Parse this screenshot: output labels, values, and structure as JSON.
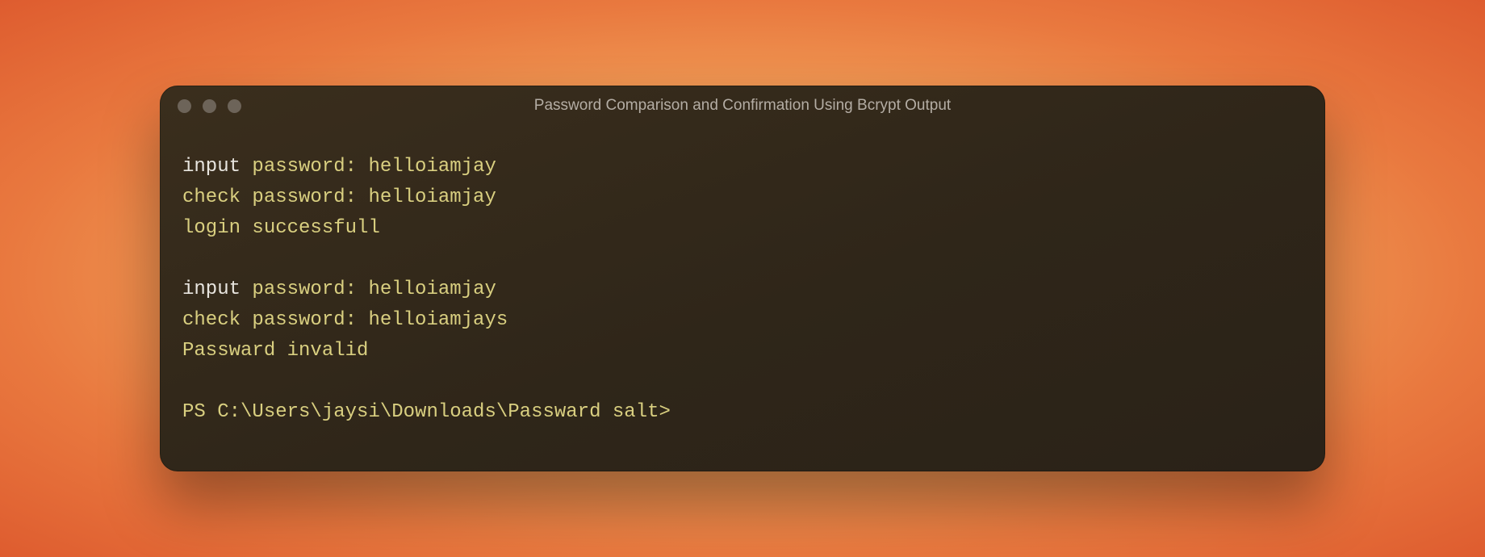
{
  "window": {
    "title": "Password Comparison and Confirmation Using Bcrypt Output"
  },
  "terminal": {
    "lines": [
      [
        {
          "text": "input",
          "cls": "tok-white"
        },
        {
          "text": " password: helloiamjay",
          "cls": "tok-yellow"
        }
      ],
      [
        {
          "text": "check password: helloiamjay",
          "cls": "tok-yellow"
        }
      ],
      [
        {
          "text": "login successfull",
          "cls": "tok-yellow"
        }
      ],
      "blank",
      [
        {
          "text": "input",
          "cls": "tok-white"
        },
        {
          "text": " password: helloiamjay",
          "cls": "tok-yellow"
        }
      ],
      [
        {
          "text": "check password: helloiamjays",
          "cls": "tok-yellow"
        }
      ],
      [
        {
          "text": "Passward invalid",
          "cls": "tok-yellow"
        }
      ],
      "blank",
      [
        {
          "text": "PS C:\\Users\\jaysi\\Downloads\\Passward salt>",
          "cls": "tok-yellow"
        }
      ]
    ]
  }
}
